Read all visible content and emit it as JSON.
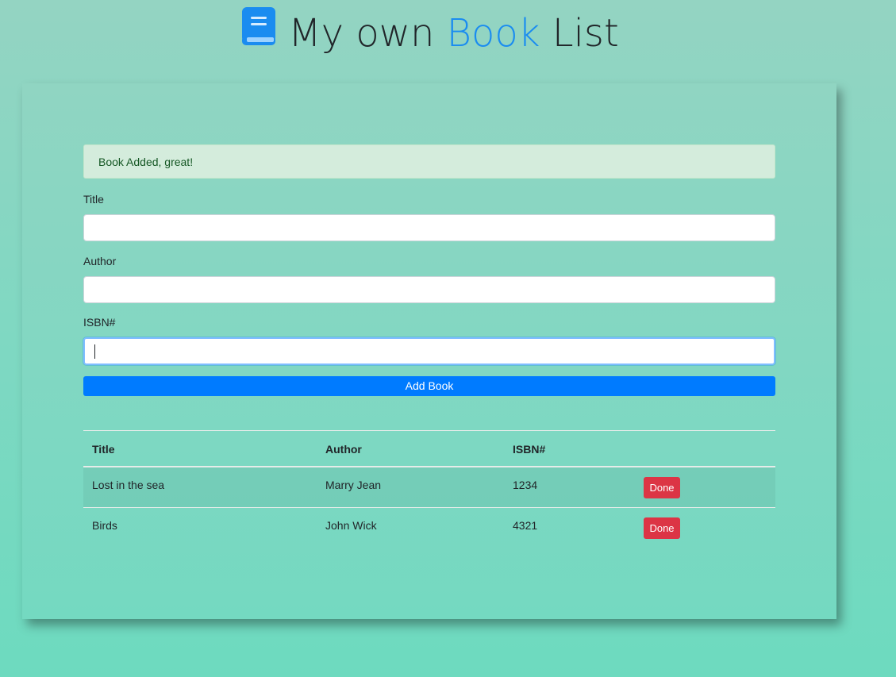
{
  "header": {
    "title_part1": "My own ",
    "title_accent": "Book",
    "title_part2": " List",
    "accent_color": "#1a8cf0",
    "icon": "book-icon"
  },
  "alert": {
    "message": "Book Added, great!"
  },
  "form": {
    "title_label": "Title",
    "title_value": "",
    "author_label": "Author",
    "author_value": "",
    "isbn_label": "ISBN#",
    "isbn_value": "",
    "submit_label": "Add Book"
  },
  "table": {
    "headers": [
      "Title",
      "Author",
      "ISBN#",
      ""
    ],
    "rows": [
      {
        "title": "Lost in the sea",
        "author": "Marry Jean",
        "isbn": "1234",
        "action": "Done"
      },
      {
        "title": "Birds",
        "author": "John Wick",
        "isbn": "4321",
        "action": "Done"
      }
    ]
  },
  "colors": {
    "primary": "#007bff",
    "danger": "#dc3545",
    "success_bg": "#d4ecdc"
  }
}
